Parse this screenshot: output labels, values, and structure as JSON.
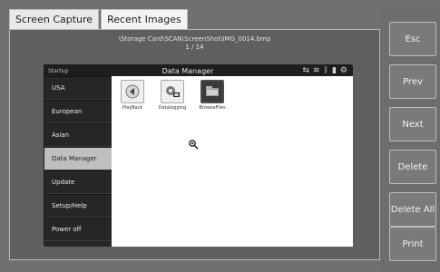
{
  "tabs": [
    {
      "label": "Screen Capture"
    },
    {
      "label": "Recent Images"
    }
  ],
  "viewer": {
    "path": "\\Storage Card\\SCAN\\ScreenShot\\IMG_0014.bmp",
    "counter": "1 / 14"
  },
  "device": {
    "header_left": "Startup",
    "title": "Data Manager",
    "status_icons": [
      "usb-icon",
      "wifi-icon",
      "bluetooth-icon",
      "battery-icon",
      "settings-icon"
    ],
    "menu": [
      {
        "label": "USA"
      },
      {
        "label": "European"
      },
      {
        "label": "Asian"
      },
      {
        "label": "Data Manager"
      },
      {
        "label": "Update"
      },
      {
        "label": "Setup/Help"
      },
      {
        "label": "Power off"
      }
    ],
    "apps": [
      {
        "label": "PlayBack"
      },
      {
        "label": "Datalogging"
      },
      {
        "label": "BrowseFiles"
      }
    ]
  },
  "actions": {
    "esc": "Esc",
    "prev": "Prev",
    "next": "Next",
    "delete": "Delete",
    "delete_all": "Delete All",
    "print": "Print"
  }
}
